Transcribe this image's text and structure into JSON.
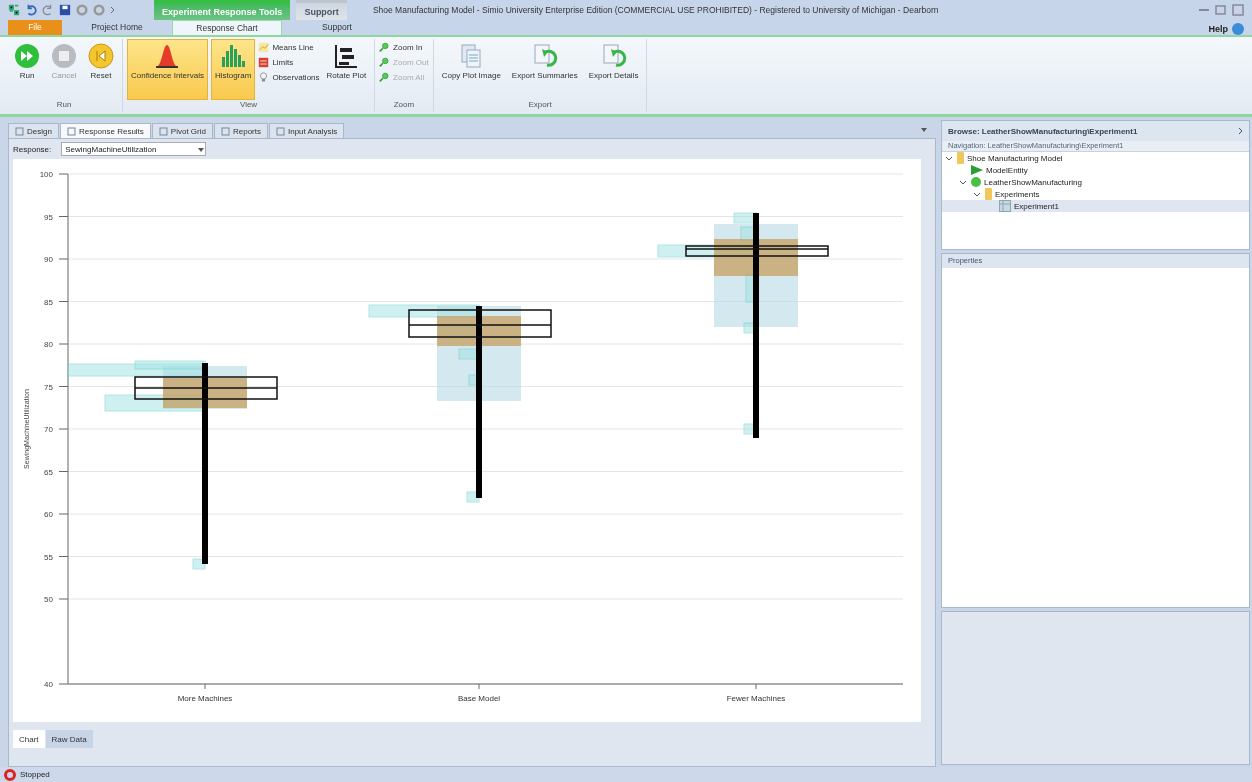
{
  "window": {
    "title": "Shoe Manufacturing Model - Simio University Enterprise Edition (COMMERCIAL USE PROHIBITED) - Registered to University of Michigan - Dearborn"
  },
  "contextual_tabs": [
    {
      "label": "Experiment Response Tools",
      "kind": "green"
    },
    {
      "label": "Support",
      "kind": "grey"
    }
  ],
  "ribbon_tabs": [
    {
      "label": "File",
      "kind": "file",
      "selected": false
    },
    {
      "label": "Project Home",
      "kind": "tab",
      "selected": false
    },
    {
      "label": "Response Chart",
      "kind": "tab",
      "selected": true
    },
    {
      "label": "Support",
      "kind": "tab",
      "selected": false
    }
  ],
  "help": "Help",
  "ribbon_groups": [
    {
      "label": "Run",
      "items": [
        {
          "label": "Run",
          "kind": "run",
          "disabled": false,
          "selected": false
        },
        {
          "label": "Cancel",
          "kind": "cancel",
          "disabled": true,
          "selected": false
        },
        {
          "label": "Reset",
          "kind": "reset",
          "disabled": false,
          "selected": false
        }
      ]
    },
    {
      "label": "View",
      "items": [
        {
          "label": "Confidence Intervals",
          "kind": "ci",
          "disabled": false,
          "selected": true
        },
        {
          "label": "Histogram",
          "kind": "histogram",
          "disabled": false,
          "selected": true
        },
        {
          "kind": "stack",
          "items": [
            {
              "label": "Means Line",
              "kind": "means",
              "disabled": false
            },
            {
              "label": "Limits",
              "kind": "limits",
              "disabled": false
            },
            {
              "label": "Observations",
              "kind": "obs",
              "disabled": false
            }
          ]
        },
        {
          "label": "Rotate Plot",
          "kind": "rotate",
          "disabled": false,
          "selected": false
        }
      ]
    },
    {
      "label": "Zoom",
      "items": [
        {
          "kind": "stack",
          "items": [
            {
              "label": "Zoom In",
              "kind": "zoom",
              "disabled": false
            },
            {
              "label": "Zoom Out",
              "kind": "zoom",
              "disabled": true
            },
            {
              "label": "Zoom All",
              "kind": "zoom",
              "disabled": true
            }
          ]
        }
      ]
    },
    {
      "label": "Export",
      "items": [
        {
          "label": "Copy Plot Image",
          "kind": "copy",
          "disabled": false,
          "selected": false
        },
        {
          "label": "Export Summaries",
          "kind": "export",
          "disabled": false,
          "selected": false
        },
        {
          "label": "Export Details",
          "kind": "export",
          "disabled": false,
          "selected": false
        }
      ]
    }
  ],
  "document_tabs": [
    {
      "label": "Design",
      "selected": false
    },
    {
      "label": "Response Results",
      "selected": true
    },
    {
      "label": "Pivot Grid",
      "selected": false
    },
    {
      "label": "Reports",
      "selected": false
    },
    {
      "label": "Input Analysis",
      "selected": false
    }
  ],
  "response": {
    "label": "Response:",
    "value": "SewingMachineUtilization"
  },
  "chart": {
    "ylabel": "SewingMachineUtilization",
    "y_ticks": [
      "100",
      "95",
      "90",
      "85",
      "80",
      "75",
      "70",
      "65",
      "60",
      "55",
      "50",
      "40"
    ],
    "categories": [
      "More Machines",
      "Base Model",
      "Fewer Machines"
    ]
  },
  "bottom_tabs": [
    {
      "label": "Chart",
      "selected": true
    },
    {
      "label": "Raw Data",
      "selected": false
    }
  ],
  "browse": {
    "title": "Browse: LeatherShowManufacturing\\Experiment1",
    "navigation": "Navigation: LeatherShowManufacturing\\Experiment1",
    "tree": [
      {
        "label": "Shoe Manufacturing Model",
        "kind": "folder",
        "expanded": true,
        "selected": false,
        "children": [
          {
            "label": "ModelEntity",
            "kind": "entity",
            "selected": false
          },
          {
            "label": "LeatherShowManufacturing",
            "kind": "model",
            "expanded": true,
            "selected": false,
            "children": [
              {
                "label": "Experiments",
                "kind": "folder",
                "expanded": true,
                "selected": false,
                "children": [
                  {
                    "label": "Experiment1",
                    "kind": "experiment",
                    "selected": true
                  }
                ]
              }
            ]
          }
        ]
      }
    ]
  },
  "properties": {
    "title": "Properties"
  },
  "status_bar": {
    "text": "Stopped"
  }
}
